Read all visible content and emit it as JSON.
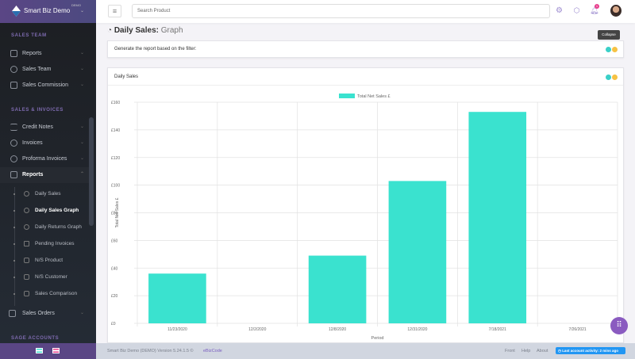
{
  "brand": {
    "name": "Smart Biz Demo",
    "tag": "DEMO"
  },
  "sidebar": {
    "sections": [
      "SALES TEAM",
      "SALES & INVOICES",
      "SAGE ACCOUNTS"
    ],
    "items": [
      {
        "label": "Reports",
        "icon": "report-icon"
      },
      {
        "label": "Sales Team",
        "icon": "team-icon"
      },
      {
        "label": "Sales Commission",
        "icon": "commission-icon"
      },
      {
        "label": "Credit Notes",
        "icon": "credit-icon"
      },
      {
        "label": "Invoices",
        "icon": "dollar-circle-icon"
      },
      {
        "label": "Proforma Invoices",
        "icon": "dollar-circle-icon"
      },
      {
        "label": "Reports",
        "icon": "report-icon"
      },
      {
        "label": "Sales Orders",
        "icon": "orders-icon"
      }
    ],
    "subitems": [
      "Daily Sales",
      "Daily Sales Graph",
      "Daily Returns Graph",
      "Pending Invoices",
      "N/S Product",
      "N/S Customer",
      "Sales Comparison"
    ]
  },
  "header": {
    "search_placeholder": "Search Product",
    "notification_count": "1"
  },
  "page": {
    "title_bold": "Daily Sales:",
    "title_light": "Graph",
    "filter_text": "Generate the report based on the filter:",
    "tooltip": "Collapse",
    "chart_card_title": "Daily Sales"
  },
  "colors": {
    "accent": "#3ae2cf",
    "yellow": "#f6c244",
    "purple": "#5a4685"
  },
  "footer": {
    "version": "Smart Biz Demo (DEMO) Version 5.24.1.5 ©",
    "company": "eBizCode",
    "links": [
      "Front",
      "Help",
      "About"
    ],
    "activity": "Last account activity: 2 mins ago"
  },
  "chart_data": {
    "type": "bar",
    "categories": [
      "11/23/2020",
      "12/2/2020",
      "12/8/2020",
      "12/31/2020",
      "7/18/2021",
      "7/26/2021"
    ],
    "series": [
      {
        "name": "Total Net Sales £",
        "values": [
          36,
          0,
          49,
          103,
          153,
          0
        ]
      }
    ],
    "xlabel": "Period",
    "ylabel": "Total Net Sales £",
    "ylim": [
      0,
      160
    ],
    "yticks": [
      "£0",
      "£20",
      "£40",
      "£60",
      "£80",
      "£100",
      "£120",
      "£140",
      "£160"
    ],
    "grid": true,
    "legend": "top-center",
    "color": "#3ae2cf"
  }
}
